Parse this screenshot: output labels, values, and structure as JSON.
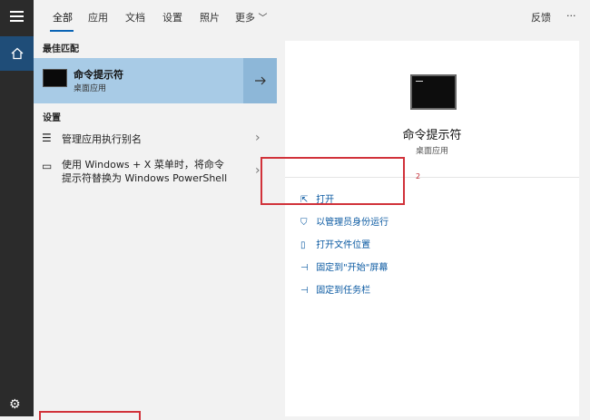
{
  "tabs": {
    "items": [
      "全部",
      "应用",
      "文档",
      "设置",
      "照片",
      "更多"
    ],
    "feedback": "反馈",
    "more_options": "···"
  },
  "left": {
    "best_match_header": "最佳匹配",
    "best_match": {
      "title": "命令提示符",
      "subtitle": "桌面应用"
    },
    "settings_header": "设置",
    "settings_items": [
      {
        "label": "管理应用执行别名"
      },
      {
        "line1": "使用 Windows + X 菜单时，将命令",
        "line2": "提示符替换为 Windows PowerShell"
      }
    ]
  },
  "preview": {
    "title": "命令提示符",
    "subtitle": "桌面应用",
    "actions": [
      "打开",
      "以管理员身份运行",
      "打开文件位置",
      "固定到\"开始\"屏幕",
      "固定到任务栏"
    ]
  },
  "annotation_marker": "2",
  "colors": {
    "accent": "#0a64b5",
    "selected": "#a8cbe6",
    "highlight": "#d1323a"
  }
}
